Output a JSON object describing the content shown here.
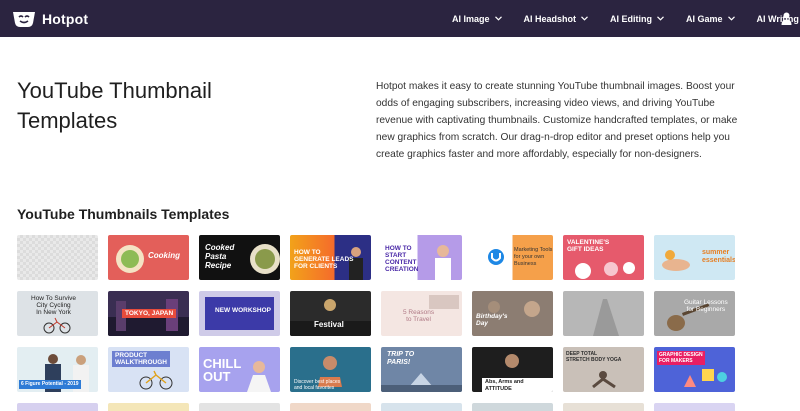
{
  "brand": {
    "name": "Hotpot"
  },
  "nav": {
    "items": [
      {
        "label": "AI Image"
      },
      {
        "label": "AI Headshot"
      },
      {
        "label": "AI Editing"
      },
      {
        "label": "AI Game"
      },
      {
        "label": "AI Writing"
      }
    ]
  },
  "hero": {
    "title": "YouTube Thumbnail Templates",
    "description": "Hotpot makes it easy to create stunning YouTube thumbnail images. Boost your odds of engaging subscribers, increasing video views, and driving YouTube revenue with captivating thumbnails. Customize handcrafted templates, or make new graphics from scratch. Our drag-n-drop editor and preset options help you create graphics faster and more affordably, especially for non-designers."
  },
  "section": {
    "title": "YouTube Thumbnails Templates"
  },
  "templates": [
    {
      "caption": ""
    },
    {
      "caption": "Cooking"
    },
    {
      "caption": "Cooked\nPasta\nRecipe"
    },
    {
      "caption": "HOW TO\nGENERATE LEADS\nFOR CLIENTS"
    },
    {
      "caption": "HOW TO\nSTART\nCONTENT\nCREATION"
    },
    {
      "caption": "Marketing Tools\nfor your own\nBusiness"
    },
    {
      "caption": "VALENTINE'S\nGIFT IDEAS"
    },
    {
      "caption": "summer\nessentials"
    },
    {
      "caption": "How To Survive\nCity Cycling\nIn New York"
    },
    {
      "caption": "TOKYO, JAPAN"
    },
    {
      "caption": "NEW WORKSHOP"
    },
    {
      "caption": "Festival"
    },
    {
      "caption": "5 Reasons\nto Travel"
    },
    {
      "caption": "Birthday's\nDay"
    },
    {
      "caption": ""
    },
    {
      "caption": "Guitar Lessons\nfor Beginners"
    },
    {
      "caption": "6 Figure Potential - 2019"
    },
    {
      "caption": "PRODUCT\nWALKTHROUGH"
    },
    {
      "caption": "CHILL\nOUT"
    },
    {
      "caption": "Discover best places\nand local favorites"
    },
    {
      "caption": "TRIP TO\nPARIS!"
    },
    {
      "caption": "Abs, Arms and ATTITUDE"
    },
    {
      "caption": "DEEP            TOTAL\nSTRETCH    BODY YOGA"
    },
    {
      "caption": "GRAPHIC DESIGN\nFOR MAKERS"
    }
  ]
}
